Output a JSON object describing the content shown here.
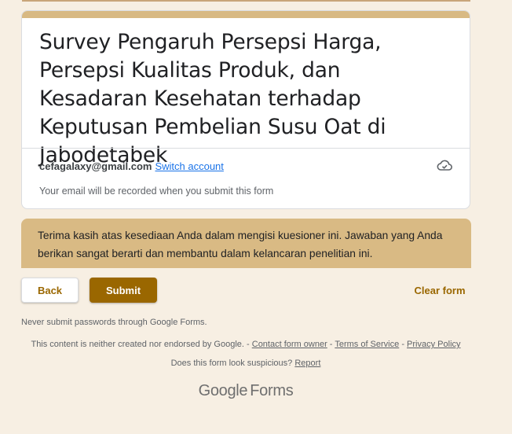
{
  "form": {
    "title": "Survey Pengaruh Persepsi Harga, Persepsi Kualitas Produk, dan Kesadaran Kesehatan terhadap Keputusan Pembelian Susu Oat di Jabodetabek",
    "account_email": "cefagalaxy@gmail.com",
    "switch_account_label": "Switch account",
    "record_note": "Your email will be recorded when you submit this form",
    "closing_message": "Terima kasih atas kesediaan Anda dalam mengisi kuesioner ini. Jawaban yang Anda berikan sangat berarti dan membantu dalam kelancaran penelitian ini."
  },
  "actions": {
    "back_label": "Back",
    "submit_label": "Submit",
    "clear_label": "Clear form"
  },
  "footer": {
    "password_warning": "Never submit passwords through Google Forms.",
    "disclaimer_prefix": "This content is neither created nor endorsed by Google. -",
    "contact_owner_label": "Contact form owner",
    "sep1": "-",
    "terms_label": "Terms of Service",
    "sep2": "-",
    "privacy_label": "Privacy Policy",
    "suspicious_prefix": "Does this form look suspicious?",
    "report_label": "Report",
    "logo_google": "Google",
    "logo_forms": "Forms"
  },
  "icons": {
    "cloud": "cloud-saved-icon"
  },
  "colors": {
    "background": "#f7efe3",
    "accent": "#d8b983",
    "primary_button": "#9a6700",
    "link": "#1a73e8"
  }
}
